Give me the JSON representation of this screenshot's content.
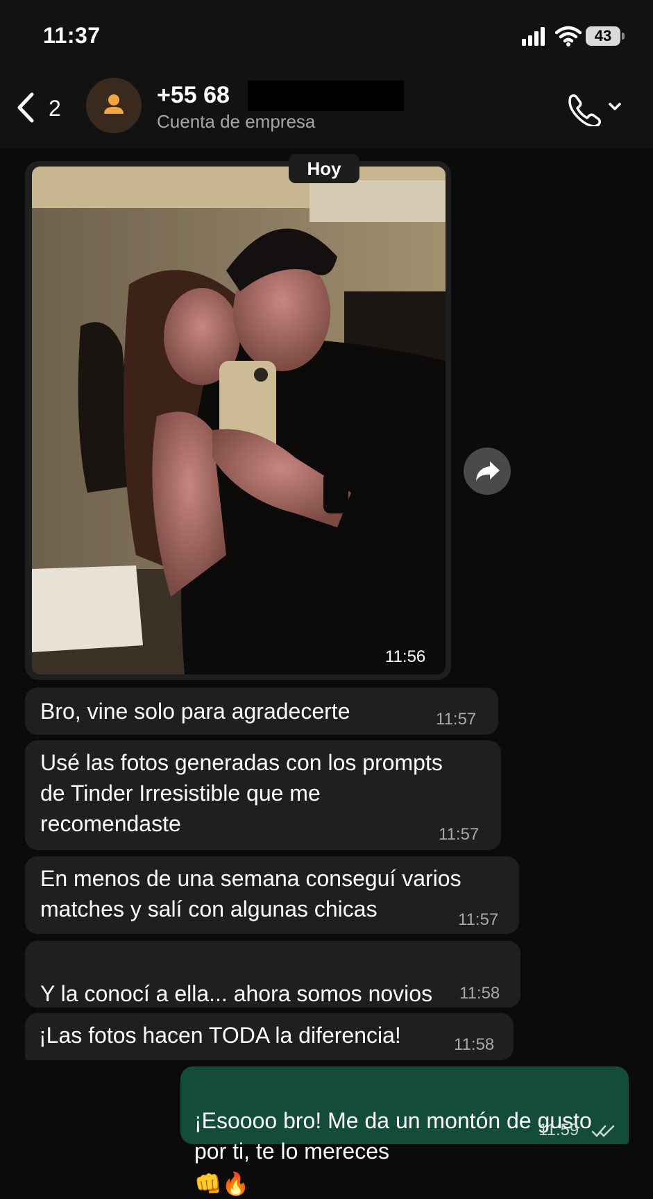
{
  "status": {
    "time": "11:37",
    "battery": "43"
  },
  "header": {
    "back_count": "2",
    "contact_name": "+55 68",
    "contact_subtitle": "Cuenta de empresa"
  },
  "chat": {
    "date_label": "Hoy",
    "photo_time": "11:56",
    "messages": [
      {
        "text": "Bro, vine solo para agradecerte",
        "time": "11:57",
        "direction": "in"
      },
      {
        "text": "Usé las fotos generadas con los prompts\nde Tinder Irresistible que me\nrecomendaste",
        "time": "11:57",
        "direction": "in"
      },
      {
        "text": "En menos de una semana conseguí varios\nmatches y salí con algunas chicas",
        "time": "11:57",
        "direction": "in"
      },
      {
        "text": "Y la conocí a ella... ahora somos novios",
        "time": "11:58",
        "direction": "in",
        "emoji": "❤️"
      },
      {
        "text": "¡Las fotos hacen TODA la diferencia!",
        "time": "11:58",
        "direction": "in"
      },
      {
        "text": "¡Esoooo bro! Me da un montón de gusto\npor ti, te lo mereces",
        "time": "11:59",
        "direction": "out",
        "emoji": "👊🔥"
      }
    ]
  },
  "colors": {
    "incoming_bubble": "#1f1f1f",
    "outgoing_bubble": "#134d37",
    "background": "#0b0b0b"
  },
  "icons": [
    "back-chevron-icon",
    "person-icon",
    "phone-icon",
    "chevron-down-icon",
    "forward-icon",
    "double-check-icon",
    "signal-icon",
    "wifi-icon",
    "battery-icon"
  ]
}
